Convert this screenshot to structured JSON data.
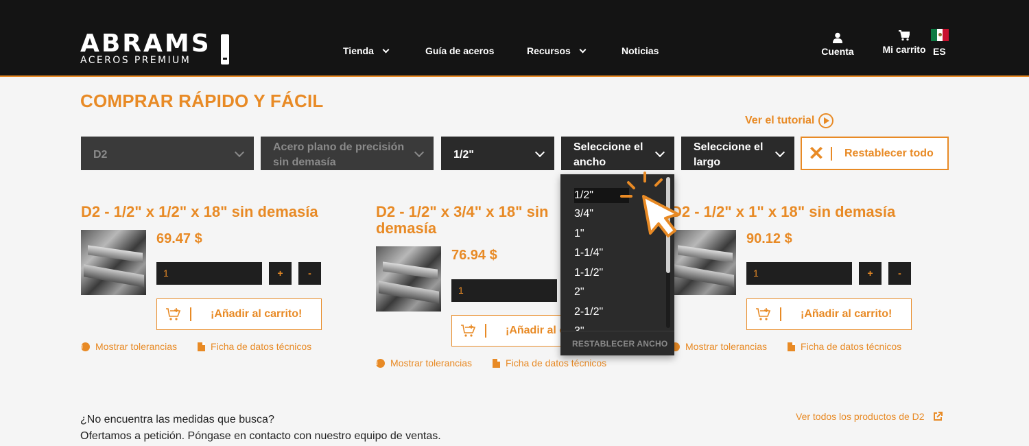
{
  "header": {
    "logo_main": "ABRAMS",
    "logo_sub": "ACEROS PREMIUM",
    "nav": [
      {
        "label": "Tienda",
        "has_dropdown": true
      },
      {
        "label": "Guía de aceros",
        "has_dropdown": false
      },
      {
        "label": "Recursos",
        "has_dropdown": true
      },
      {
        "label": "Noticias",
        "has_dropdown": false
      }
    ],
    "account_label": "Cuenta",
    "cart_label": "Mi carrito",
    "language": "ES"
  },
  "main": {
    "title": "COMPRAR RÁPIDO Y FÁCIL",
    "tutorial_link": "Ver el tutorial",
    "filters": [
      {
        "value": "D2",
        "disabled": true
      },
      {
        "value": "Acero plano de precisión sin demasía",
        "disabled": true
      },
      {
        "value": "1/2\"",
        "disabled": false
      },
      {
        "value": "Seleccione el ancho",
        "disabled": false
      },
      {
        "value": "Seleccione el largo",
        "disabled": false
      }
    ],
    "reset_all": "Restablecer todo"
  },
  "dropdown": {
    "options": [
      "1/2\"",
      "3/4\"",
      "1\"",
      "1-1/4\"",
      "1-1/2\"",
      "2\"",
      "2-1/2\"",
      "3\""
    ],
    "highlighted": "1/2\"",
    "footer": "RESTABLECER ANCHO"
  },
  "products": [
    {
      "title": "D2 - 1/2\" x 1/2\" x 18\" sin demasía",
      "price": "69.47 $",
      "qty": "1",
      "plus": "+",
      "minus": "-",
      "add_to_cart": "¡Añadir al carrito!",
      "tolerances": "Mostrar tolerancias",
      "datasheet": "Ficha de datos técnicos"
    },
    {
      "title": "D2 - 1/2\" x 3/4\" x 18\" sin demasía",
      "price": "76.94 $",
      "qty": "1",
      "plus": "+",
      "minus": "-",
      "add_to_cart": "¡Añadir al carrito!",
      "tolerances": "Mostrar tolerancias",
      "datasheet": "Ficha de datos técnicos"
    },
    {
      "title": "D2 - 1/2\" x 1\" x 18\" sin demasía",
      "price": "90.12 $",
      "qty": "1",
      "plus": "+",
      "minus": "-",
      "add_to_cart": "¡Añadir al carrito!",
      "tolerances": "Mostrar tolerancias",
      "datasheet": "Ficha de datos técnicos"
    }
  ],
  "footer": {
    "line1": "¿No encuentra las medidas que busca?",
    "line2": "Ofertamos a petición. Póngase en contacto con nuestro equipo de ventas.",
    "all_products_link": "Ver todos los productos de D2"
  },
  "colors": {
    "accent": "#e88a25",
    "header_bg": "#141414",
    "select_bg": "#2a2a2a"
  }
}
